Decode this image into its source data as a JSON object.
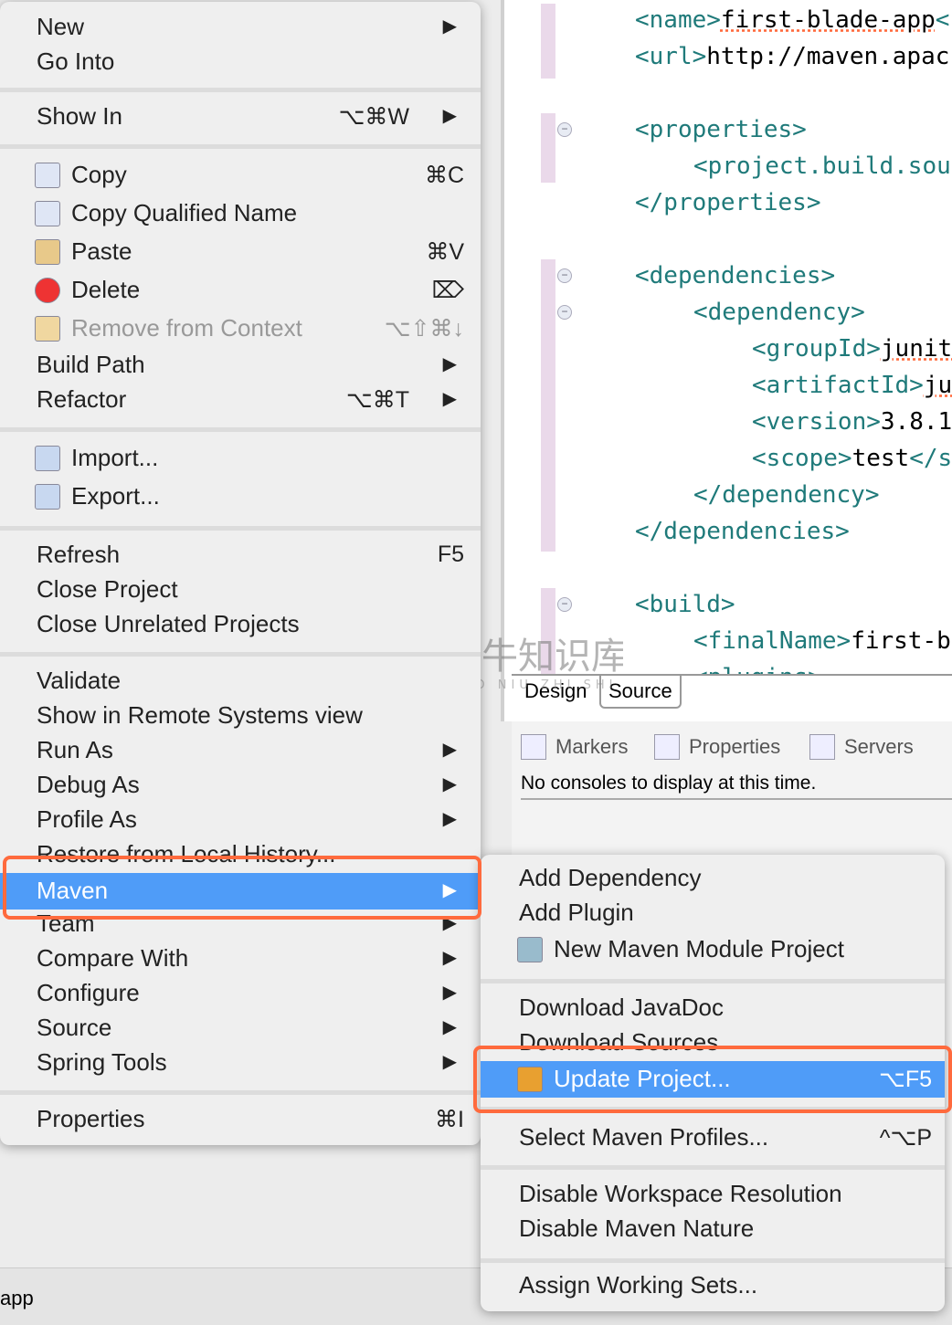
{
  "editor": {
    "lines": [
      {
        "indent": 0,
        "tag_open": "<name>",
        "text": "first-blade-app",
        "tag_close": "<",
        "squiggle": "app"
      },
      {
        "indent": 0,
        "tag_open": "<url>",
        "text": "http://maven.apac",
        "tag_close": ""
      },
      {
        "indent": 0,
        "tag_open": "<properties>",
        "text": "",
        "tag_close": ""
      },
      {
        "indent": 1,
        "tag_open": "<project.build.sou",
        "text": "",
        "tag_close": ""
      },
      {
        "indent": 0,
        "tag_open": "</properties>",
        "text": "",
        "tag_close": ""
      },
      {
        "indent": 0,
        "tag_open": "<dependencies>",
        "text": "",
        "tag_close": ""
      },
      {
        "indent": 1,
        "tag_open": "<dependency>",
        "text": "",
        "tag_close": ""
      },
      {
        "indent": 2,
        "tag_open": "<groupId>",
        "text": "junit",
        "tag_close": "",
        "squiggle": "junit"
      },
      {
        "indent": 2,
        "tag_open": "<artifactId>",
        "text": "ju",
        "tag_close": "",
        "squiggle": "ju"
      },
      {
        "indent": 2,
        "tag_open": "<version>",
        "text": "3.8.1",
        "tag_close": ""
      },
      {
        "indent": 2,
        "tag_open": "<scope>",
        "text": "test",
        "tag_close": "</s"
      },
      {
        "indent": 1,
        "tag_open": "</dependency>",
        "text": "",
        "tag_close": ""
      },
      {
        "indent": 0,
        "tag_open": "</dependencies>",
        "text": "",
        "tag_close": ""
      },
      {
        "indent": 0,
        "tag_open": "<build>",
        "text": "",
        "tag_close": ""
      },
      {
        "indent": 1,
        "tag_open": "<finalName>",
        "text": "first-b",
        "tag_close": ""
      },
      {
        "indent": 1,
        "tag_open": "<plugins>",
        "text": "",
        "tag_close": ""
      }
    ],
    "tabs": [
      "Design",
      "Source"
    ],
    "active_tab": "Source"
  },
  "panel": {
    "tabs": [
      {
        "label": "Markers",
        "icon": "markers-icon"
      },
      {
        "label": "Properties",
        "icon": "properties-icon"
      },
      {
        "label": "Servers",
        "icon": "servers-icon"
      }
    ],
    "console_message": "No consoles to display at this time."
  },
  "status_bar": {
    "text": "app"
  },
  "context_menu": {
    "items": [
      {
        "label": "New",
        "arrow": true
      },
      {
        "label": "Go Into"
      },
      {
        "sep": true
      },
      {
        "label": "Show In",
        "shortcut": "⌥⌘W",
        "arrow": true
      },
      {
        "sep": true
      },
      {
        "label": "Copy",
        "shortcut": "⌘C",
        "icon": "copy-icon"
      },
      {
        "label": "Copy Qualified Name",
        "icon": "copy-qualified-name-icon"
      },
      {
        "label": "Paste",
        "shortcut": "⌘V",
        "icon": "paste-icon"
      },
      {
        "label": "Delete",
        "shortcut": "⌦",
        "icon": "delete-icon"
      },
      {
        "label": "Remove from Context",
        "shortcut": "⌥⇧⌘↓",
        "icon": "remove-context-icon",
        "disabled": true
      },
      {
        "label": "Build Path",
        "arrow": true
      },
      {
        "label": "Refactor",
        "shortcut": "⌥⌘T",
        "arrow": true
      },
      {
        "sep": true
      },
      {
        "label": "Import...",
        "icon": "import-icon"
      },
      {
        "label": "Export...",
        "icon": "export-icon"
      },
      {
        "sep": true
      },
      {
        "label": "Refresh",
        "shortcut": "F5"
      },
      {
        "label": "Close Project"
      },
      {
        "label": "Close Unrelated Projects"
      },
      {
        "sep": true
      },
      {
        "label": "Validate"
      },
      {
        "label": "Show in Remote Systems view"
      },
      {
        "label": "Run As",
        "arrow": true
      },
      {
        "label": "Debug As",
        "arrow": true
      },
      {
        "label": "Profile As",
        "arrow": true
      },
      {
        "label": "Restore from Local History..."
      },
      {
        "label": "Maven",
        "arrow": true,
        "highlighted": true
      },
      {
        "label": "Team",
        "arrow": true
      },
      {
        "label": "Compare With",
        "arrow": true
      },
      {
        "label": "Configure",
        "arrow": true
      },
      {
        "label": "Source",
        "arrow": true
      },
      {
        "label": "Spring Tools",
        "arrow": true
      },
      {
        "sep": true
      },
      {
        "label": "Properties",
        "shortcut": "⌘I"
      }
    ]
  },
  "maven_submenu": {
    "items": [
      {
        "label": "Add Dependency"
      },
      {
        "label": "Add Plugin"
      },
      {
        "label": "New Maven Module Project",
        "icon": "maven-module-icon"
      },
      {
        "sep": true
      },
      {
        "label": "Download JavaDoc"
      },
      {
        "label": "Download Sources"
      },
      {
        "label": "Update Project...",
        "shortcut": "⌥F5",
        "icon": "update-project-icon",
        "highlighted": true
      },
      {
        "sep": true
      },
      {
        "label": "Select Maven Profiles...",
        "shortcut": "^⌥P"
      },
      {
        "sep": true
      },
      {
        "label": "Disable Workspace Resolution"
      },
      {
        "label": "Disable Maven Nature"
      },
      {
        "sep": true
      },
      {
        "label": "Assign Working Sets..."
      }
    ]
  },
  "colors": {
    "highlight": "#4f9cf8",
    "annotation": "#ff6a3d",
    "xml_tag": "#1f7a7a"
  },
  "watermark": {
    "text": "小牛知识库",
    "subtext": "XIAO NIU ZHI SHI KU"
  }
}
